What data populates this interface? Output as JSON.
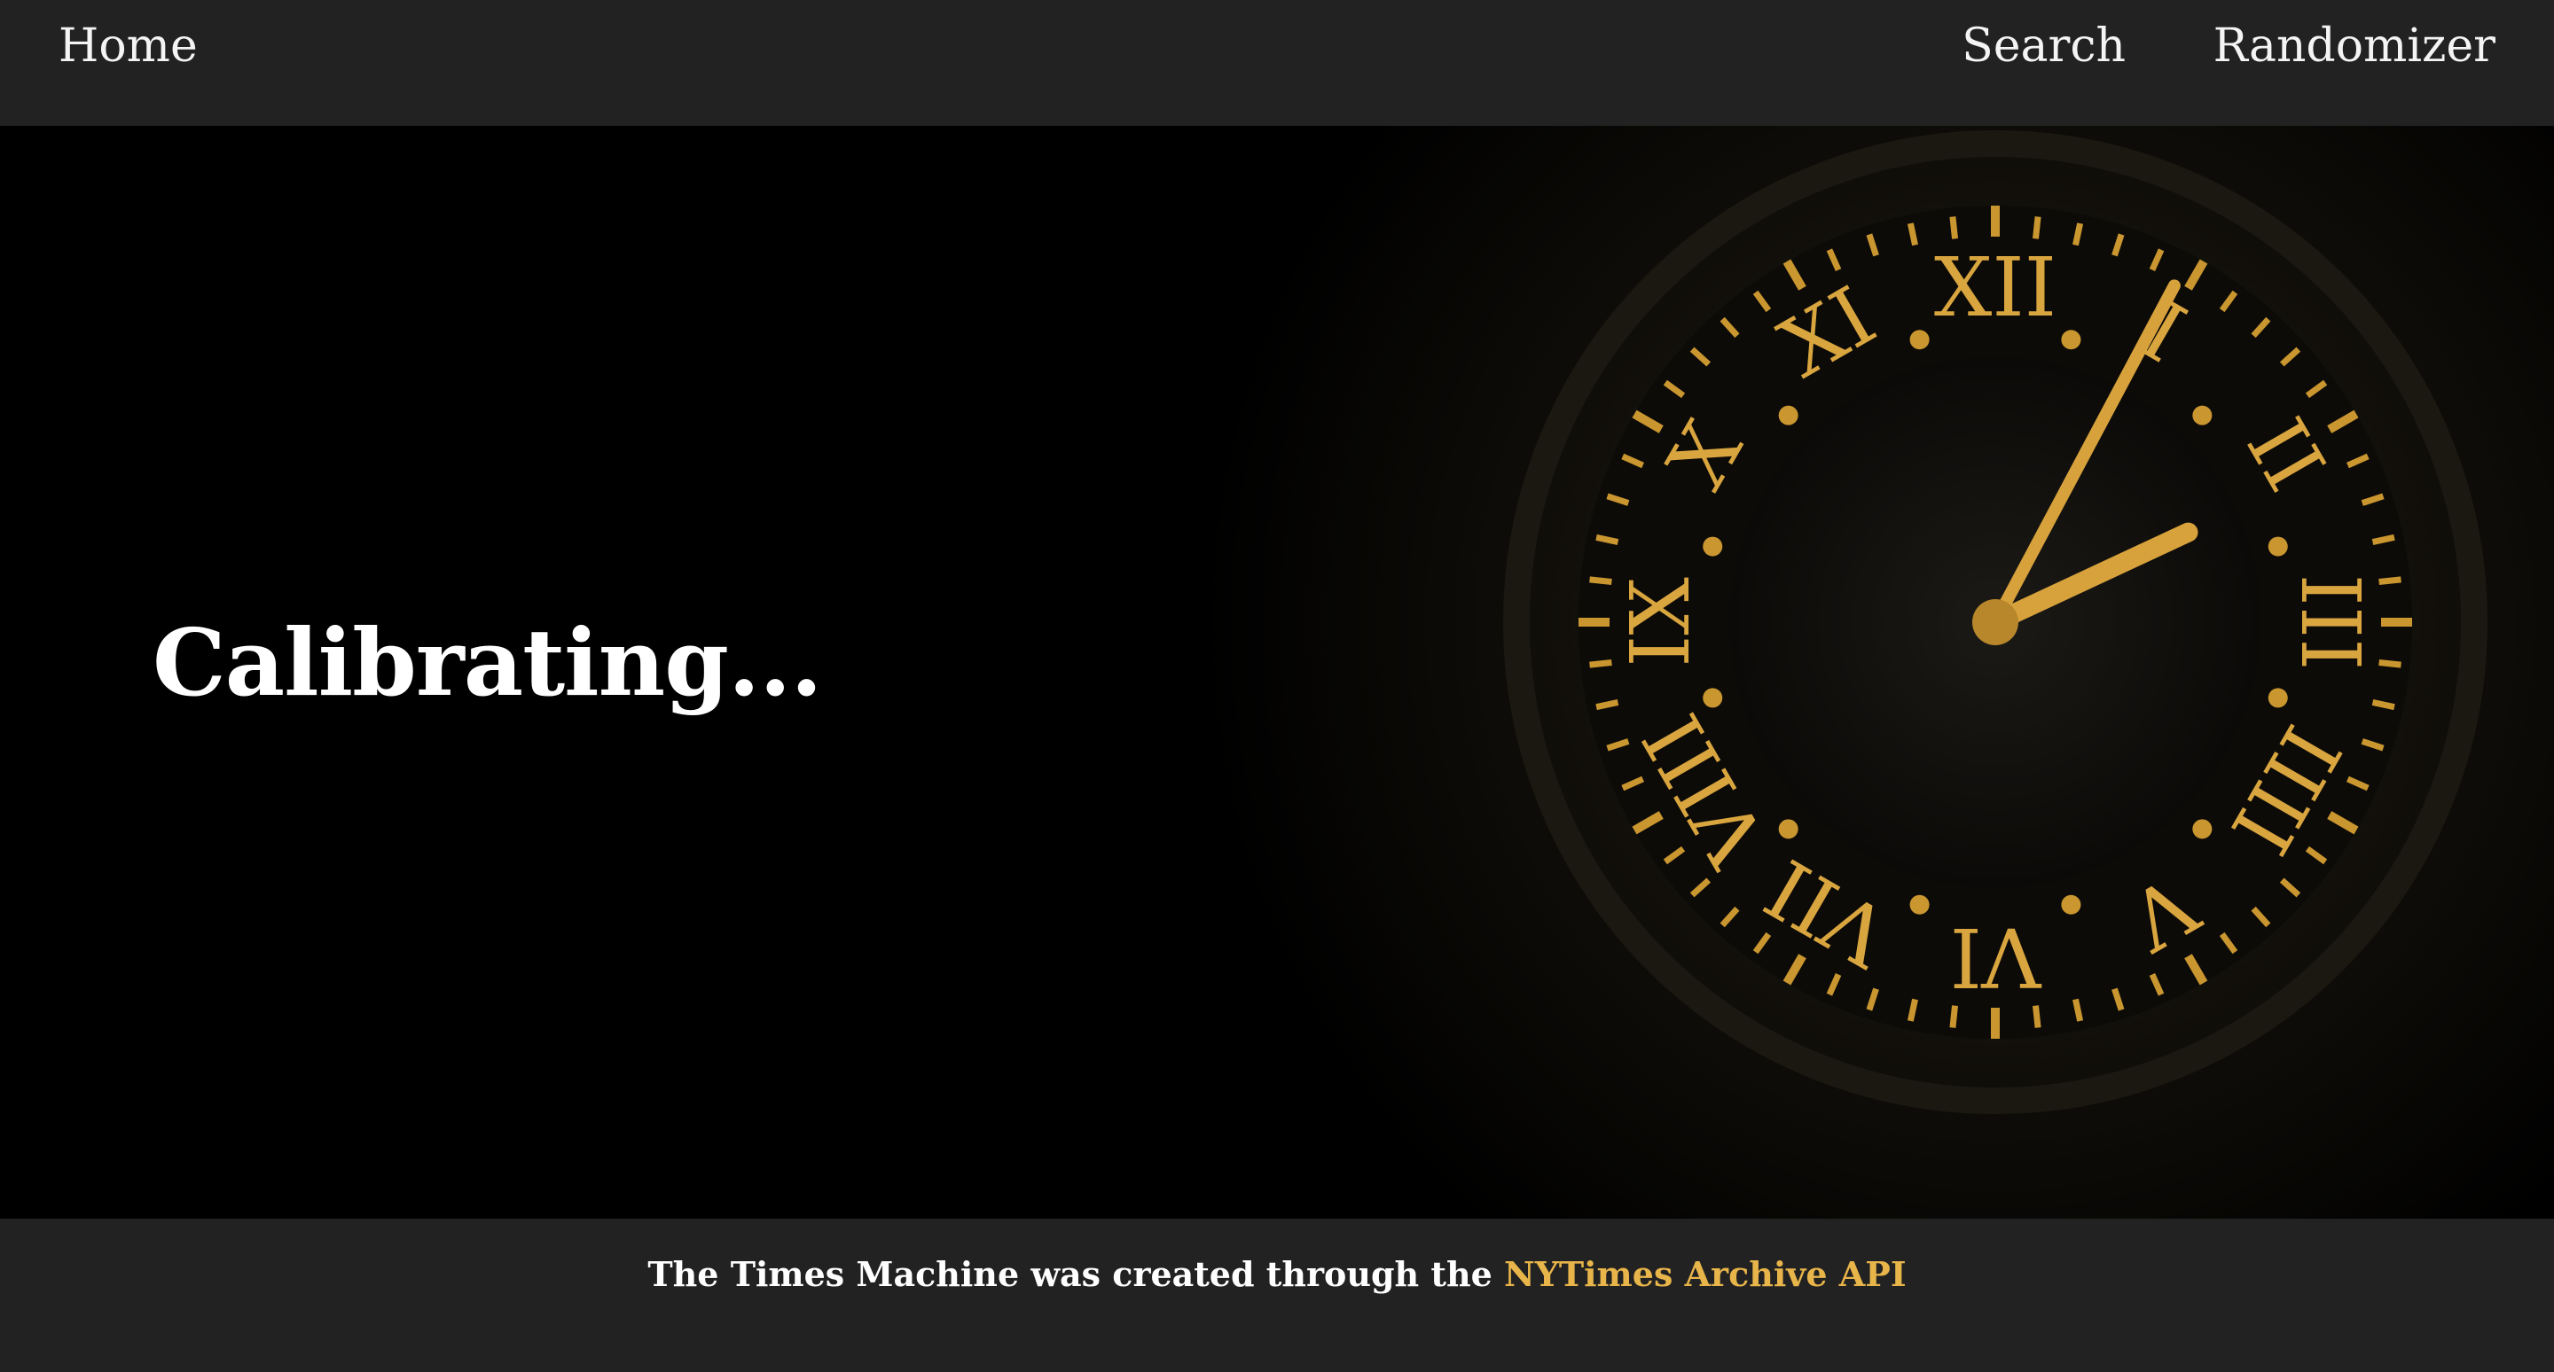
{
  "nav": {
    "home_label": "Home",
    "search_label": "Search",
    "randomizer_label": "Randomizer"
  },
  "hero": {
    "title": "Calibrating...",
    "image": "ornate-gold-clock-face",
    "clock_numerals": [
      "XII",
      "I",
      "II",
      "III",
      "IIII",
      "V",
      "VI",
      "VII",
      "VIII",
      "IX",
      "X",
      "XI"
    ]
  },
  "footer": {
    "text_prefix": "The Times Machine was created through the ",
    "link_label": "NYTimes Archive API"
  },
  "colors": {
    "bar_background": "#222222",
    "hero_background": "#000000",
    "accent_gold": "#e8b54a",
    "text": "#ffffff"
  }
}
